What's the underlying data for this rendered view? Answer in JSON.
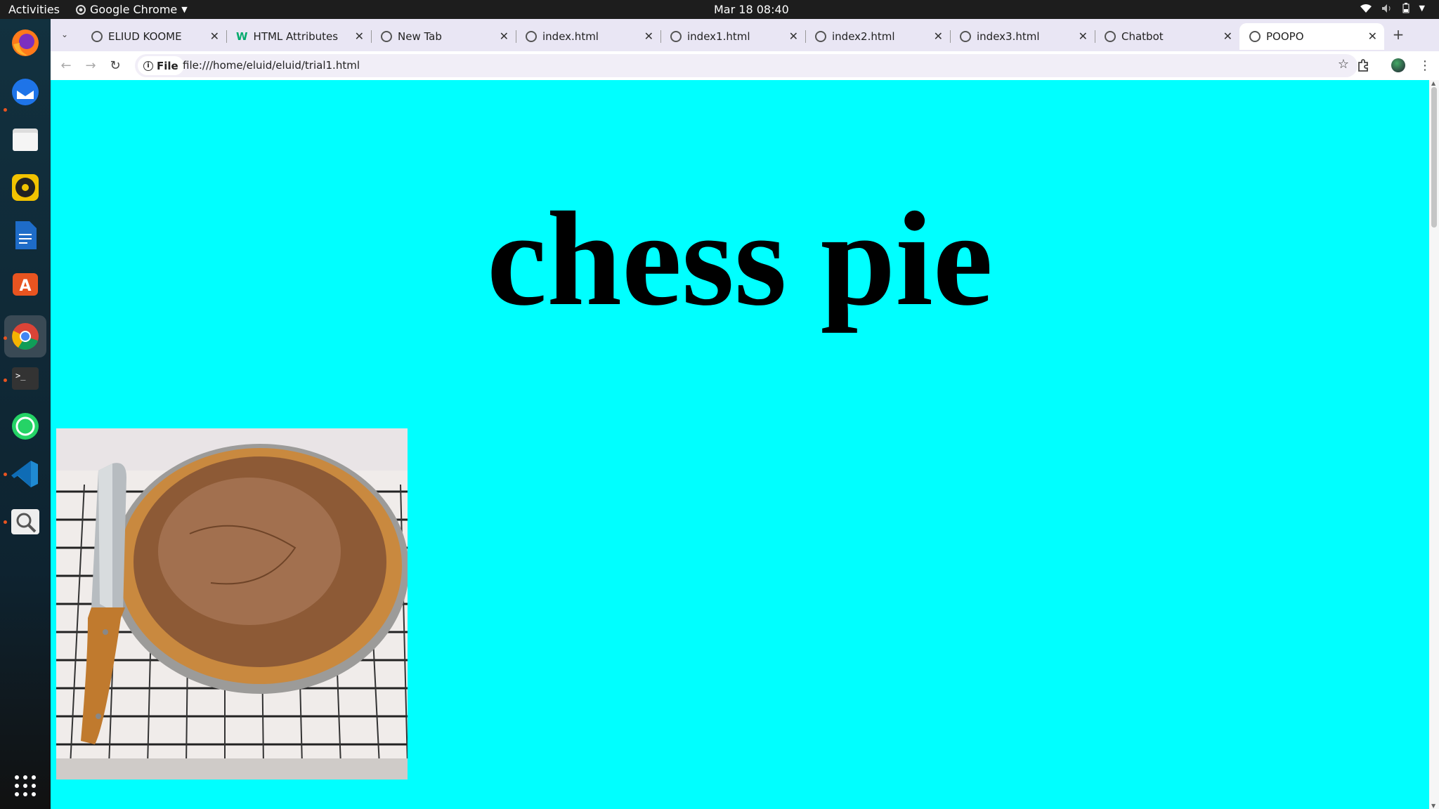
{
  "system_bar": {
    "activities": "Activities",
    "app_name": "Google Chrome",
    "clock": "Mar 18  08:40"
  },
  "browser": {
    "tabs": [
      {
        "label": "ELIUD KOOME",
        "active": false
      },
      {
        "label": "HTML Attributes",
        "active": false
      },
      {
        "label": "New Tab",
        "active": false
      },
      {
        "label": "index.html",
        "active": false
      },
      {
        "label": "index1.html",
        "active": false
      },
      {
        "label": "index2.html",
        "active": false
      },
      {
        "label": "index3.html",
        "active": false
      },
      {
        "label": "Chatbot",
        "active": false
      },
      {
        "label": "POOPO",
        "active": true
      }
    ],
    "new_tab_symbol": "+",
    "address": {
      "scheme_chip": "File",
      "url": "file:///home/eluid/eluid/trial1.html"
    }
  },
  "page": {
    "background": "#00ffff",
    "heading": "chess pie"
  },
  "dock": {
    "apps": [
      "firefox-icon",
      "thunderbird-icon",
      "files-icon",
      "rhythmbox-icon",
      "writer-icon",
      "app-center-icon",
      "chrome-icon",
      "terminal-icon",
      "whatsapp-icon",
      "vscode-icon",
      "image-viewer-icon"
    ],
    "grid": "show-apps-icon"
  }
}
